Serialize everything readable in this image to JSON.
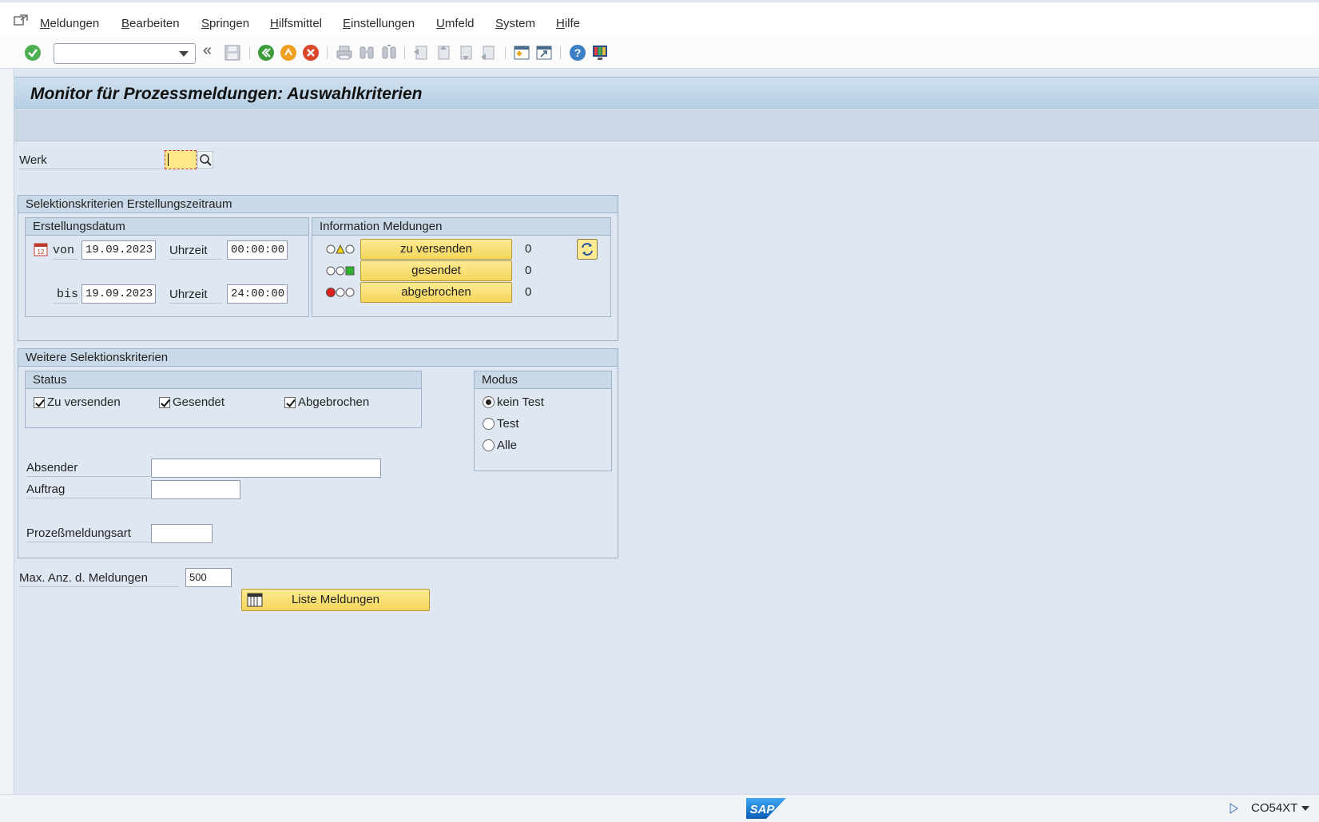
{
  "menu": {
    "items": [
      "Meldungen",
      "Bearbeiten",
      "Springen",
      "Hilfsmittel",
      "Einstellungen",
      "Umfeld",
      "System",
      "Hilfe"
    ]
  },
  "toolbar": {
    "command_value": ""
  },
  "page": {
    "title": "Monitor für Prozessmeldungen: Auswahlkriterien"
  },
  "werk": {
    "label": "Werk",
    "value": ""
  },
  "group_zeitraum": {
    "title": "Selektionskriterien Erstellungszeitraum",
    "erstellungsdatum": {
      "title": "Erstellungsdatum",
      "von_label": "von",
      "von_date": "19.09.2023",
      "von_time_label": "Uhrzeit",
      "von_time": "00:00:00",
      "bis_label": "bis",
      "bis_date": "19.09.2023",
      "bis_time_label": "Uhrzeit",
      "bis_time": "24:00:00"
    },
    "info": {
      "title": "Information Meldungen",
      "rows": [
        {
          "label": "zu versenden",
          "count": "0"
        },
        {
          "label": "gesendet",
          "count": "0"
        },
        {
          "label": "abgebrochen",
          "count": "0"
        }
      ]
    }
  },
  "group_weitere": {
    "title": "Weitere Selektionskriterien",
    "status": {
      "title": "Status",
      "options": [
        {
          "label": "Zu versenden",
          "checked": true
        },
        {
          "label": "Gesendet",
          "checked": true
        },
        {
          "label": "Abgebrochen",
          "checked": true
        }
      ]
    },
    "modus": {
      "title": "Modus",
      "options": [
        {
          "label": "kein Test",
          "selected": true
        },
        {
          "label": "Test",
          "selected": false
        },
        {
          "label": "Alle",
          "selected": false
        }
      ]
    },
    "absender_label": "Absender",
    "absender_value": "",
    "auftrag_label": "Auftrag",
    "auftrag_value": "",
    "prozess_label": "Prozeßmeldungsart",
    "prozess_value": ""
  },
  "max": {
    "label": "Max. Anz. d. Meldungen",
    "value": "500"
  },
  "liste_button": "Liste Meldungen",
  "status_bar": {
    "system": "CO54XT",
    "logo": "SAP"
  }
}
